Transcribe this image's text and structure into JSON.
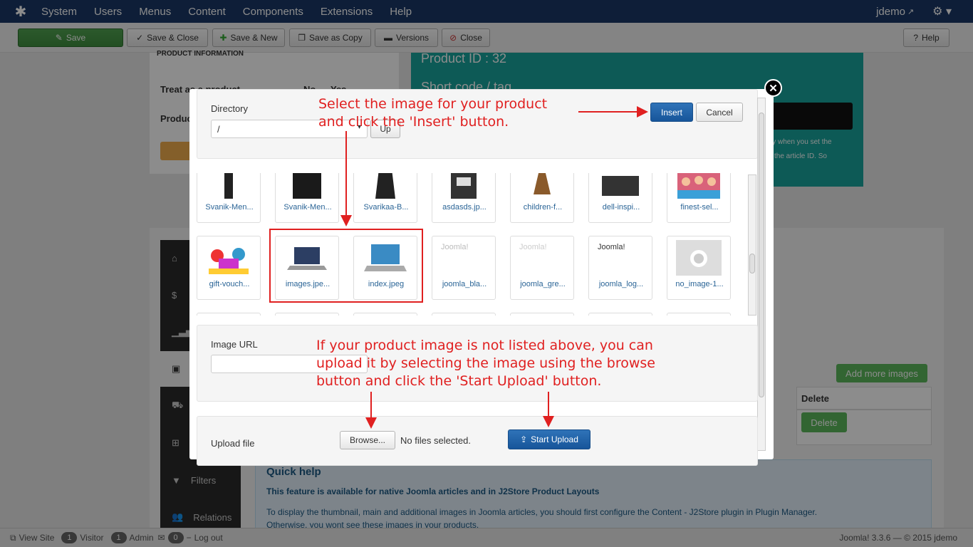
{
  "nav": {
    "items": [
      "System",
      "Users",
      "Menus",
      "Content",
      "Components",
      "Extensions",
      "Help"
    ],
    "user": "jdemo"
  },
  "toolbar": {
    "save": "Save",
    "save_close": "Save & Close",
    "save_new": "Save & New",
    "save_copy": "Save as Copy",
    "versions": "Versions",
    "close": "Close",
    "help": "Help"
  },
  "background": {
    "section_title": "PRODUCT INFORMATION",
    "treat_label": "Treat as a product",
    "treat_no": "No",
    "treat_yes": "Yes",
    "product_label": "Produc",
    "product_id": "Product ID : 32",
    "short_code": "Short code / tag",
    "note_line1": "ly when you set the",
    "note_line2": "the article ID. So",
    "add_more_images": "Add more images",
    "delete_header": "Delete",
    "delete_button": "Delete",
    "sidebar_filters": "Filters",
    "sidebar_relations": "Relations",
    "quick_help_title": "Quick help",
    "quick_help_bold": "This feature is available for native Joomla articles and in J2Store Product Layouts",
    "quick_help_text": "To display the thumbnail, main and additional images in Joomla articles, you should first configure the Content - J2Store plugin in Plugin Manager.",
    "quick_help_text2": "Otherwise, you wont see these images in your products."
  },
  "modal": {
    "directory_label": "Directory",
    "directory_value": "/",
    "up_button": "Up",
    "insert_button": "Insert",
    "cancel_button": "Cancel",
    "images_row1": [
      "Svanik-Men...",
      "Svanik-Men...",
      "Svarikaa-B...",
      "asdasds.jp...",
      "children-f...",
      "dell-inspi...",
      "finest-sel..."
    ],
    "images_row2": [
      "gift-vouch...",
      "images.jpe...",
      "index.jpeg",
      "joomla_bla...",
      "joomla_gre...",
      "joomla_log...",
      "no_image-1..."
    ],
    "joomla_logo_text": "Joomla!",
    "image_url_label": "Image URL",
    "image_url_value": "",
    "upload_label": "Upload file",
    "browse_button": "Browse...",
    "no_files": "No files selected.",
    "start_upload": "Start Upload"
  },
  "annotations": {
    "top_line1": "Select the image for your product",
    "top_line2": "and click the 'Insert' button.",
    "bottom_line1": "If your product image is not listed above, you can",
    "bottom_line2": "upload it by selecting the image using the browse",
    "bottom_line3": "button and click the 'Start Upload' button."
  },
  "status": {
    "view_site": "View Site",
    "visitor_count": "1",
    "visitor_label": "Visitor",
    "admin_count": "1",
    "admin_label": "Admin",
    "msg_count": "0",
    "logout": "Log out",
    "version": "Joomla! 3.3.6 — © 2015 jdemo"
  },
  "colors": {
    "nav_bg": "#1a3867",
    "teal": "#19a59d",
    "annotation_red": "#e02020",
    "primary_blue": "#17559a",
    "success_green": "#51a351"
  }
}
